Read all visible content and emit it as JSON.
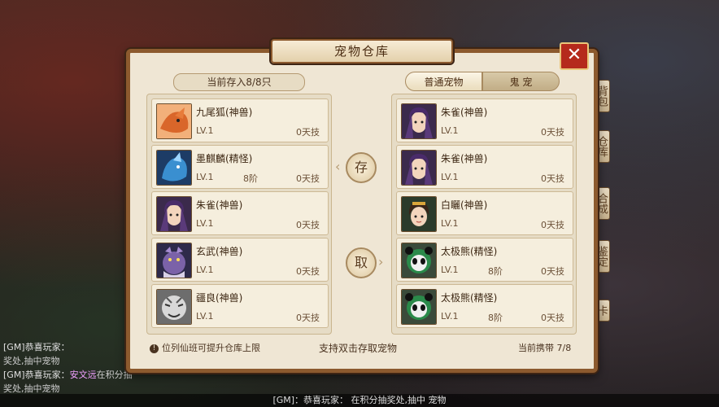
{
  "background": {
    "side_tabs": [
      {
        "label": "背包"
      },
      {
        "label": "仓库"
      },
      {
        "label": "合成"
      },
      {
        "label": "鉴定"
      },
      {
        "label": "卡"
      }
    ],
    "chat": [
      {
        "prefix": "[GM]恭喜玩家：",
        "player": "",
        "text": ""
      },
      {
        "prefix": "奖处,抽中",
        "player": "",
        "text": "宠物"
      },
      {
        "prefix": "[GM]恭喜玩家：",
        "player": "安文远",
        "text": "在积分抽"
      },
      {
        "prefix": "奖处,抽中",
        "player": "",
        "text": "宠物"
      }
    ],
    "bottom_ticker": "[GM]：恭喜玩家：                在积分抽奖处,抽中                宠物"
  },
  "panel": {
    "title": "宠物仓库",
    "close_label": "✕",
    "stored_count": "当前存入8/8只",
    "tabs": [
      {
        "label": "普通宠物",
        "active": true
      },
      {
        "label": "鬼  宠",
        "active": false
      }
    ],
    "deposit_label": "存",
    "withdraw_label": "取",
    "hint": "位列仙班可提升仓库上限",
    "double_click_hint": "支持双击存取宠物",
    "carry_count": "当前携带 7/8",
    "left_pets": [
      {
        "name": "九尾狐(神兽)",
        "level": "LV.1",
        "stage": "",
        "skills": "0天技",
        "avatar": "fox"
      },
      {
        "name": "墨麒麟(精怪)",
        "level": "LV.1",
        "stage": "8阶",
        "skills": "0天技",
        "avatar": "qilin"
      },
      {
        "name": "朱雀(神兽)",
        "level": "LV.1",
        "stage": "",
        "skills": "0天技",
        "avatar": "zhuque"
      },
      {
        "name": "玄武(神兽)",
        "level": "LV.1",
        "stage": "",
        "skills": "0天技",
        "avatar": "xuanwu"
      },
      {
        "name": "疆良(神兽)",
        "level": "LV.1",
        "stage": "",
        "skills": "0天技",
        "avatar": "jiangliang"
      }
    ],
    "right_pets": [
      {
        "name": "朱雀(神兽)",
        "level": "LV.1",
        "stage": "",
        "skills": "0天技",
        "avatar": "zhuque"
      },
      {
        "name": "朱雀(神兽)",
        "level": "LV.1",
        "stage": "",
        "skills": "0天技",
        "avatar": "zhuque"
      },
      {
        "name": "白矖(神兽)",
        "level": "LV.1",
        "stage": "",
        "skills": "0天技",
        "avatar": "baixi"
      },
      {
        "name": "太极熊(精怪)",
        "level": "LV.1",
        "stage": "8阶",
        "skills": "0天技",
        "avatar": "panda"
      },
      {
        "name": "太极熊(精怪)",
        "level": "LV.1",
        "stage": "8阶",
        "skills": "0天技",
        "avatar": "panda"
      }
    ]
  }
}
